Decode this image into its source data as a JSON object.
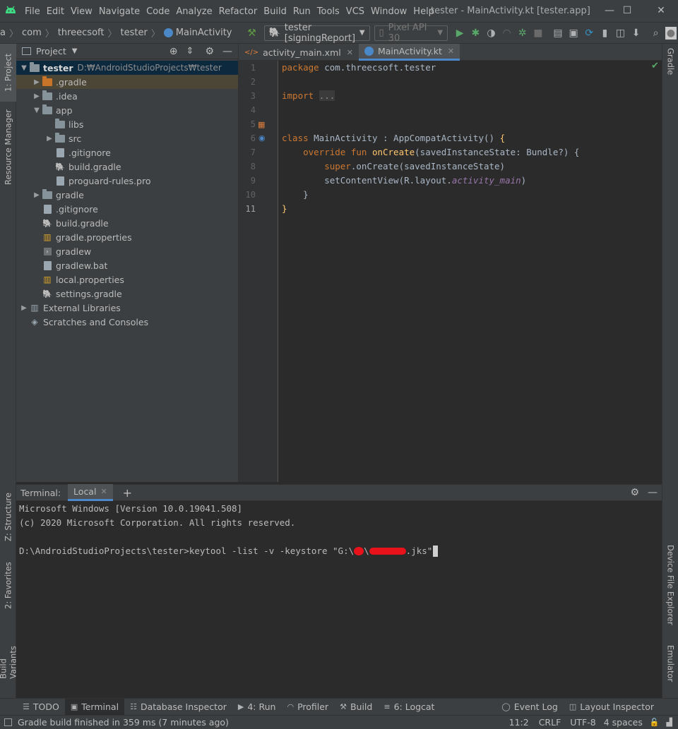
{
  "window": {
    "title": "tester - MainActivity.kt [tester.app]"
  },
  "menu": [
    "File",
    "Edit",
    "View",
    "Navigate",
    "Code",
    "Analyze",
    "Refactor",
    "Build",
    "Run",
    "Tools",
    "VCS",
    "Window",
    "Help"
  ],
  "navbar": {
    "crumbs": [
      "a",
      "com",
      "threecsoft",
      "tester",
      "MainActivity"
    ],
    "run_config": "tester [signingReport]",
    "device": "Pixel API 30"
  },
  "left_strip": {
    "project": "1: Project",
    "resource_manager": "Resource Manager",
    "structure": "Z: Structure",
    "favorites": "2: Favorites",
    "build_variants": "Build Variants"
  },
  "right_strip": {
    "gradle": "Gradle",
    "device_file_explorer": "Device File Explorer",
    "emulator": "Emulator"
  },
  "project_panel": {
    "title": "Project",
    "tree": [
      {
        "label": "tester",
        "extra": "D:₩AndroidStudioProjects₩tester",
        "depth": 0,
        "expanded": "open",
        "icon": "module"
      },
      {
        "label": ".gradle",
        "depth": 1,
        "expanded": "closed",
        "icon": "folder-orange"
      },
      {
        "label": ".idea",
        "depth": 1,
        "expanded": "closed",
        "icon": "folder"
      },
      {
        "label": "app",
        "depth": 1,
        "expanded": "open",
        "icon": "module"
      },
      {
        "label": "libs",
        "depth": 2,
        "expanded": "none",
        "icon": "folder"
      },
      {
        "label": "src",
        "depth": 2,
        "expanded": "closed",
        "icon": "folder"
      },
      {
        "label": ".gitignore",
        "depth": 2,
        "expanded": "none",
        "icon": "file"
      },
      {
        "label": "build.gradle",
        "depth": 2,
        "expanded": "none",
        "icon": "gradle"
      },
      {
        "label": "proguard-rules.pro",
        "depth": 2,
        "expanded": "none",
        "icon": "file"
      },
      {
        "label": "gradle",
        "depth": 1,
        "expanded": "closed",
        "icon": "folder"
      },
      {
        "label": ".gitignore",
        "depth": 1,
        "expanded": "none",
        "icon": "file"
      },
      {
        "label": "build.gradle",
        "depth": 1,
        "expanded": "none",
        "icon": "gradle"
      },
      {
        "label": "gradle.properties",
        "depth": 1,
        "expanded": "none",
        "icon": "props"
      },
      {
        "label": "gradlew",
        "depth": 1,
        "expanded": "none",
        "icon": "shell"
      },
      {
        "label": "gradlew.bat",
        "depth": 1,
        "expanded": "none",
        "icon": "file"
      },
      {
        "label": "local.properties",
        "depth": 1,
        "expanded": "none",
        "icon": "props"
      },
      {
        "label": "settings.gradle",
        "depth": 1,
        "expanded": "none",
        "icon": "gradle"
      },
      {
        "label": "External Libraries",
        "depth": 0,
        "expanded": "closed",
        "icon": "libs"
      },
      {
        "label": "Scratches and Consoles",
        "depth": 0,
        "expanded": "none",
        "icon": "scratch"
      }
    ]
  },
  "editor": {
    "tabs": [
      {
        "label": "activity_main.xml",
        "active": false
      },
      {
        "label": "MainActivity.kt",
        "active": true
      }
    ],
    "line_numbers": [
      "1",
      "2",
      "3",
      "4",
      "5",
      "6",
      "7",
      "8",
      "9",
      "10",
      "11"
    ],
    "lines": [
      [
        {
          "t": "package ",
          "c": "kw"
        },
        {
          "t": "com.threecsoft.tester",
          "c": ""
        }
      ],
      [],
      [
        {
          "t": "import ",
          "c": "kw"
        },
        {
          "t": "...",
          "c": "fold"
        }
      ],
      [],
      [],
      [
        {
          "t": "class ",
          "c": "kw"
        },
        {
          "t": "MainActivity : AppCompatActivity() ",
          "c": ""
        },
        {
          "t": "{",
          "c": "fn"
        }
      ],
      [
        {
          "t": "    override fun ",
          "c": "kw"
        },
        {
          "t": "onCreate",
          "c": "fn"
        },
        {
          "t": "(savedInstanceState: Bundle?) {",
          "c": ""
        }
      ],
      [
        {
          "t": "        super",
          "c": "kw"
        },
        {
          "t": ".onCreate(savedInstanceState)",
          "c": ""
        }
      ],
      [
        {
          "t": "        setContentView(R.layout.",
          "c": ""
        },
        {
          "t": "activity_main",
          "c": "it"
        },
        {
          "t": ")",
          "c": ""
        }
      ],
      [
        {
          "t": "    }",
          "c": ""
        }
      ],
      [
        {
          "t": "}",
          "c": "fn"
        }
      ]
    ]
  },
  "terminal": {
    "label": "Terminal:",
    "tab": "Local",
    "lines": [
      "Microsoft Windows [Version 10.0.19041.508]",
      "(c) 2020 Microsoft Corporation. All rights reserved.",
      "",
      "D:\\AndroidStudioProjects\\tester>keytool -list -v -keystore \"G:\\",
      "\\",
      ".jks\""
    ]
  },
  "bottom_tabs": [
    {
      "label": "TODO",
      "icon": "list-icon",
      "active": false
    },
    {
      "label": "Terminal",
      "icon": "terminal-icon",
      "active": true
    },
    {
      "label": "Database Inspector",
      "icon": "database-icon",
      "active": false
    },
    {
      "label": "4: Run",
      "icon": "run-icon",
      "active": false
    },
    {
      "label": "Profiler",
      "icon": "profiler-icon",
      "active": false
    },
    {
      "label": "Build",
      "icon": "hammer-icon",
      "active": false
    },
    {
      "label": "6: Logcat",
      "icon": "logcat-icon",
      "active": false
    }
  ],
  "bottom_tabs_right": [
    {
      "label": "Event Log",
      "icon": "event-log-icon"
    },
    {
      "label": "Layout Inspector",
      "icon": "layout-inspector-icon"
    }
  ],
  "status": {
    "message": "Gradle build finished in 359 ms (7 minutes ago)",
    "position": "11:2",
    "line_sep": "CRLF",
    "encoding": "UTF-8",
    "indent": "4 spaces"
  },
  "colors": {
    "keyword": "#cc7832",
    "function": "#ffc66d",
    "accent": "#4a88c7",
    "android_green": "#3ddc84"
  }
}
